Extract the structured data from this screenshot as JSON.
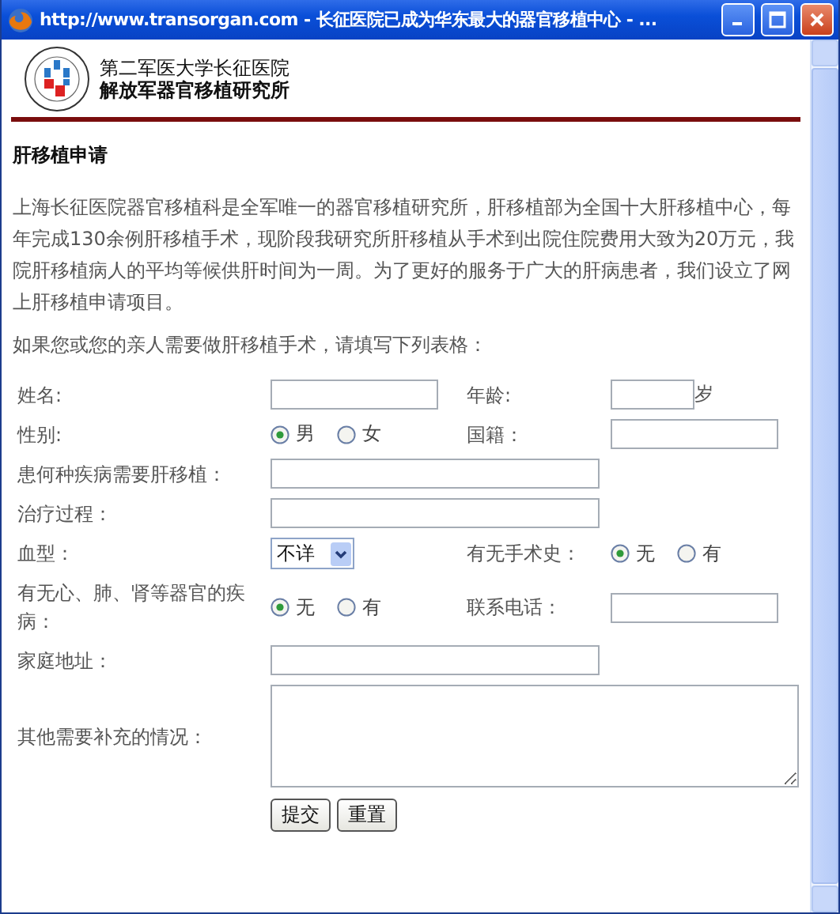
{
  "window": {
    "title": "http://www.transorgan.com - 长征医院已成为华东最大的器官移植中心 - ..."
  },
  "header": {
    "org_lines": [
      "第二军医大学长征医院",
      "解放军器官移植研究所"
    ]
  },
  "heading": "肝移植申请",
  "intro": "上海长征医院器官移植科是全军唯一的器官移植研究所，肝移植部为全国十大肝移植中心，每年完成130余例肝移植手术，现阶段我研究所肝移植从手术到出院住院费用大致为20万元，我院肝移植病人的平均等候供肝时间为一周。为了更好的服务于广大的肝病患者，我们设立了网上肝移植申请项目。",
  "instruction": "如果您或您的亲人需要做肝移植手术，请填写下列表格：",
  "form_rows": [
    {
      "cells": [
        {
          "kind": "label",
          "text": "姓名:"
        },
        {
          "kind": "input"
        },
        {
          "kind": "label",
          "text": "年龄:"
        },
        {
          "kind": "narrow-input",
          "suffix": "岁"
        }
      ]
    },
    {
      "cells": [
        {
          "kind": "label",
          "text": "性别:"
        },
        {
          "kind": "radio",
          "options": [
            {
              "label": "男",
              "selected": true
            },
            {
              "label": "女",
              "selected": false
            }
          ]
        },
        {
          "kind": "label",
          "text": "国籍："
        },
        {
          "kind": "input"
        }
      ]
    },
    {
      "cells": [
        {
          "kind": "label",
          "text": "患何种疾病需要肝移植："
        },
        {
          "kind": "long-input"
        }
      ]
    },
    {
      "cells": [
        {
          "kind": "label",
          "text": "治疗过程："
        },
        {
          "kind": "long-input"
        }
      ]
    },
    {
      "cells": [
        {
          "kind": "label",
          "text": "血型："
        },
        {
          "kind": "select",
          "value": "不详"
        },
        {
          "kind": "label",
          "text": "有无手术史："
        },
        {
          "kind": "radio",
          "options": [
            {
              "label": "无",
              "selected": true
            },
            {
              "label": "有",
              "selected": false
            }
          ]
        }
      ]
    },
    {
      "cells": [
        {
          "kind": "label",
          "text": "有无心、肺、肾等器官的疾病："
        },
        {
          "kind": "radio",
          "options": [
            {
              "label": "无",
              "selected": true
            },
            {
              "label": "有",
              "selected": false
            }
          ]
        },
        {
          "kind": "label",
          "text": "联系电话："
        },
        {
          "kind": "input"
        }
      ]
    },
    {
      "cells": [
        {
          "kind": "label",
          "text": "家庭地址："
        },
        {
          "kind": "long-input"
        }
      ]
    },
    {
      "cells": [
        {
          "kind": "label",
          "text": "其他需要补充的情况："
        },
        {
          "kind": "textarea"
        }
      ]
    }
  ],
  "buttons": [
    "提交",
    "重置"
  ]
}
